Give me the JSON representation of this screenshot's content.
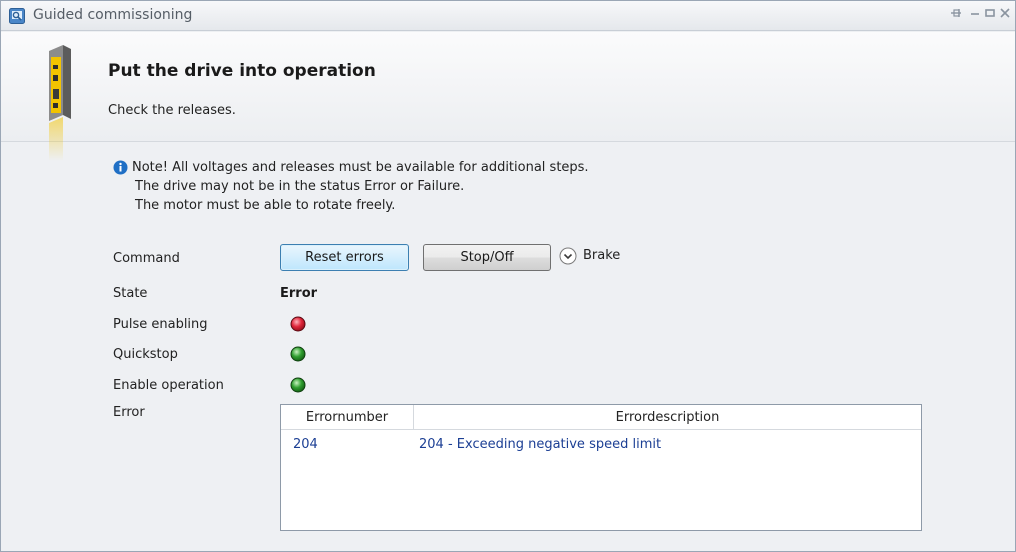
{
  "window": {
    "title": "Guided commissioning",
    "pin_label": "⍔",
    "minimize_label": "–",
    "maximize_label": "▬",
    "close_label": "X"
  },
  "header": {
    "title": "Put the drive into operation",
    "subtitle": "Check the releases."
  },
  "note": {
    "icon": "info-icon",
    "lines": [
      "Note! All voltages and releases must be available for additional steps.",
      "The drive may not be in the status Error or Failure.",
      "The motor must be able to rotate freely."
    ]
  },
  "labels": {
    "command": "Command",
    "state": "State",
    "pulse_enabling": "Pulse enabling",
    "quickstop": "Quickstop",
    "enable_operation": "Enable operation",
    "error": "Error"
  },
  "buttons": {
    "reset_errors": "Reset errors",
    "stop_off": "Stop/Off",
    "brake": "Brake"
  },
  "state_value": "Error",
  "indicators": {
    "pulse_enabling": {
      "status": "off",
      "color": "#e0263a"
    },
    "quickstop": {
      "status": "on",
      "color": "#2f9e2f"
    },
    "enable_operation": {
      "status": "on",
      "color": "#2f9e2f"
    }
  },
  "error_table": {
    "columns": [
      "Errornumber",
      "Errordescription"
    ],
    "rows": [
      {
        "number": "204",
        "description": "204 - Exceeding negative speed limit"
      }
    ]
  },
  "colors": {
    "accent": "#3c7fb1",
    "link_text": "#1c3f94",
    "drive_yellow": "#f2c300"
  }
}
